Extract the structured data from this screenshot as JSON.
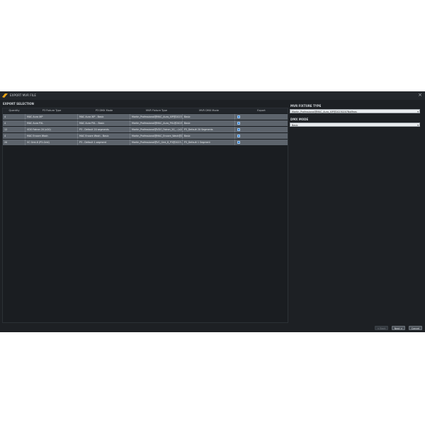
{
  "window": {
    "title": "EXPORT MVR FILE",
    "close_glyph": "×"
  },
  "export_selection": {
    "label": "EXPORT SELECTION",
    "columns": [
      "Quantity",
      "P3 Fixture Type",
      "P3 DMX Mode",
      "MVR Fixture Type",
      "MVR DMX Mode",
      "Export"
    ],
    "rows": [
      {
        "quantity": "4",
        "p3_type": "MAC Aura XIP",
        "p3_mode": "MAC Aura XIP - Basic",
        "mvr_type": "Martin_Professional@MAC_Aura_XIP@20231...",
        "mvr_mode": "Basic",
        "export": true
      },
      {
        "quantity": "4",
        "p3_type": "MAC Aura PXL",
        "p3_mode": "MAC Aura PXL - Basic",
        "mvr_type": "Martin_Professional@MAC_Aura_PXL@2023...",
        "mvr_mode": "Basic",
        "export": true
      },
      {
        "quantity": "12",
        "p3_type": "VDO Fatron 20 (x20)",
        "p3_mode": "P3 - Default 20 segments",
        "mvr_type": "Martin_Professional@VDO_Fatron_20_...(x20)...",
        "mvr_mode": "P3_Default 20 Segments",
        "export": true
      },
      {
        "quantity": "4",
        "p3_type": "MAC Encore Wash",
        "p3_mode": "MAC Encore Wash - Basic",
        "mvr_type": "Martin_Professional@MAC_Encore_Wash@20...",
        "mvr_mode": "Basic",
        "export": true
      },
      {
        "quantity": "20",
        "p3_type": "VC Grid-8 (P3-Grid)",
        "p3_mode": "P3 - Default 1 segment",
        "mvr_type": "Martin_Professional@VC_Grid_8_P3@2023...",
        "mvr_mode": "P3_Default 1 Segment",
        "export": true
      }
    ]
  },
  "mvr_fixture_type": {
    "label": "MVR FIXTURE TYPE",
    "value": "Martin_Professional@MAC_Aura_XIP@20230207NoMeas"
  },
  "dmx_mode": {
    "label": "DMX MODE",
    "value": "Basic"
  },
  "buttons": {
    "back": "< Back",
    "next": "Next >",
    "cancel": "Cancel"
  },
  "colors": {
    "dialog_bg": "#1d2024",
    "row_bg": "#5d646c",
    "check_accent": "#2f7fd0",
    "logo": "#e8a317"
  },
  "icons": {
    "logo": "martin-logo-icon",
    "close": "close-icon",
    "check": "checkbox-checked-icon",
    "dropdown": "chevron-down-icon"
  }
}
